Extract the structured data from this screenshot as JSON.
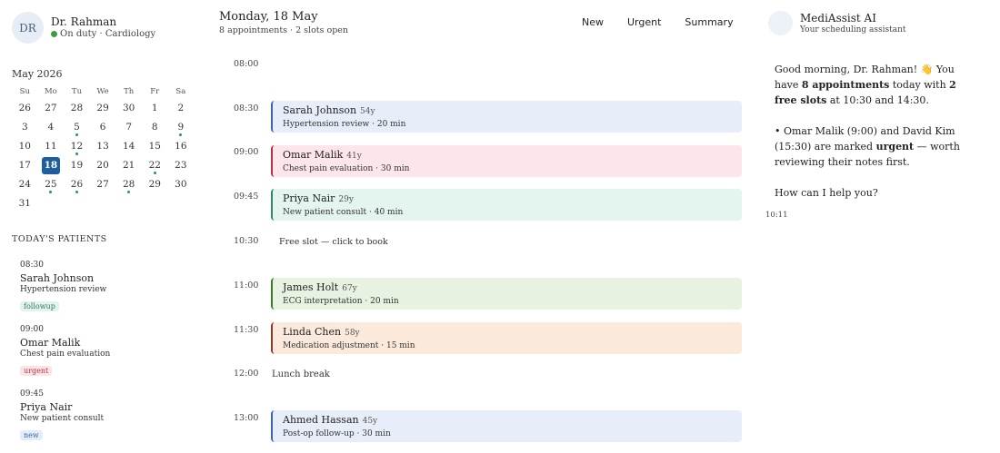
{
  "doctor": {
    "initials": "DR",
    "name": "Dr. Rahman",
    "status": "On duty · Cardiology",
    "status_color": "#3d9a3d"
  },
  "calendar": {
    "title": "May 2026",
    "days_of_week": [
      "Su",
      "Mo",
      "Tu",
      "We",
      "Th",
      "Fr",
      "Sa"
    ],
    "selected_day": "18",
    "days": [
      {
        "d": "26",
        "ev": false
      },
      {
        "d": "27",
        "ev": false
      },
      {
        "d": "28",
        "ev": false
      },
      {
        "d": "29",
        "ev": false
      },
      {
        "d": "30",
        "ev": false
      },
      {
        "d": "1",
        "ev": false
      },
      {
        "d": "2",
        "ev": false
      },
      {
        "d": "3",
        "ev": false
      },
      {
        "d": "4",
        "ev": false
      },
      {
        "d": "5",
        "ev": true
      },
      {
        "d": "6",
        "ev": false
      },
      {
        "d": "7",
        "ev": false
      },
      {
        "d": "8",
        "ev": false
      },
      {
        "d": "9",
        "ev": true
      },
      {
        "d": "10",
        "ev": false
      },
      {
        "d": "11",
        "ev": false
      },
      {
        "d": "12",
        "ev": true
      },
      {
        "d": "13",
        "ev": false
      },
      {
        "d": "14",
        "ev": false
      },
      {
        "d": "15",
        "ev": false
      },
      {
        "d": "16",
        "ev": false
      },
      {
        "d": "17",
        "ev": false
      },
      {
        "d": "18",
        "ev": false
      },
      {
        "d": "19",
        "ev": false
      },
      {
        "d": "20",
        "ev": false
      },
      {
        "d": "21",
        "ev": false
      },
      {
        "d": "22",
        "ev": true
      },
      {
        "d": "23",
        "ev": false
      },
      {
        "d": "24",
        "ev": false
      },
      {
        "d": "25",
        "ev": true
      },
      {
        "d": "26",
        "ev": true
      },
      {
        "d": "27",
        "ev": false
      },
      {
        "d": "28",
        "ev": true
      },
      {
        "d": "29",
        "ev": false
      },
      {
        "d": "30",
        "ev": false
      },
      {
        "d": "31",
        "ev": false
      }
    ]
  },
  "patients": {
    "title": "TODAY'S PATIENTS",
    "items": [
      {
        "time": "08:30",
        "name": "Sarah Johnson",
        "reason": "Hypertension review",
        "tag": "followup",
        "tag_bg": "#e2f3ee",
        "tag_fg": "#2f7a63"
      },
      {
        "time": "09:00",
        "name": "Omar Malik",
        "reason": "Chest pain evaluation",
        "tag": "urgent",
        "tag_bg": "#fbe3e6",
        "tag_fg": "#b8394f"
      },
      {
        "time": "09:45",
        "name": "Priya Nair",
        "reason": "New patient consult",
        "tag": "new",
        "tag_bg": "#e3ecf8",
        "tag_fg": "#3b66a3"
      }
    ]
  },
  "main": {
    "date": "Monday, 18 May",
    "summary": "8 appointments · 2 slots open",
    "actions": [
      "New",
      "Urgent",
      "Summary"
    ]
  },
  "schedule": {
    "times": [
      "08:00",
      "08:30",
      "09:00",
      "09:45",
      "10:30",
      "11:00",
      "11:30",
      "12:00",
      "13:00"
    ],
    "appointments": [
      {
        "name": "Sarah Johnson",
        "age": "54y",
        "detail": "Hypertension review · 20 min",
        "bg": "#e8eef9",
        "border": "#3d64a8"
      },
      {
        "name": "Omar Malik",
        "age": "41y",
        "detail": "Chest pain evaluation · 30 min",
        "bg": "#fce6ea",
        "border": "#b3304a"
      },
      {
        "name": "Priya Nair",
        "age": "29y",
        "detail": "New patient consult · 40 min",
        "bg": "#e4f4ee",
        "border": "#2e8a66"
      },
      {
        "name": "James Holt",
        "age": "67y",
        "detail": "ECG interpretation · 20 min",
        "bg": "#e8f2e1",
        "border": "#3c7a2c"
      },
      {
        "name": "Linda Chen",
        "age": "58y",
        "detail": "Medication adjustment · 15 min",
        "bg": "#fbeadb",
        "border": "#8a3a2a"
      },
      {
        "name": "Ahmed Hassan",
        "age": "45y",
        "detail": "Post-op follow-up · 30 min",
        "bg": "#e8eef9",
        "border": "#3d64a8"
      }
    ],
    "free_slot": "Free slot — click to book",
    "lunch": "Lunch break"
  },
  "assistant": {
    "name": "MediAssist AI",
    "subtitle": "Your scheduling assistant",
    "greeting_pre": "Good morning, Dr. Rahman! 👋 You have ",
    "greeting_count": "8 appointments",
    "greeting_mid": " today with ",
    "greeting_free": "2 free slots",
    "greeting_post": " at 10:30 and 14:30.",
    "urgent_pre": "• Omar Malik (9:00) and David Kim (15:30) are marked ",
    "urgent_word": "urgent",
    "urgent_post": " — worth reviewing their notes first.",
    "question": "How can I help you?",
    "time": "10:11"
  }
}
